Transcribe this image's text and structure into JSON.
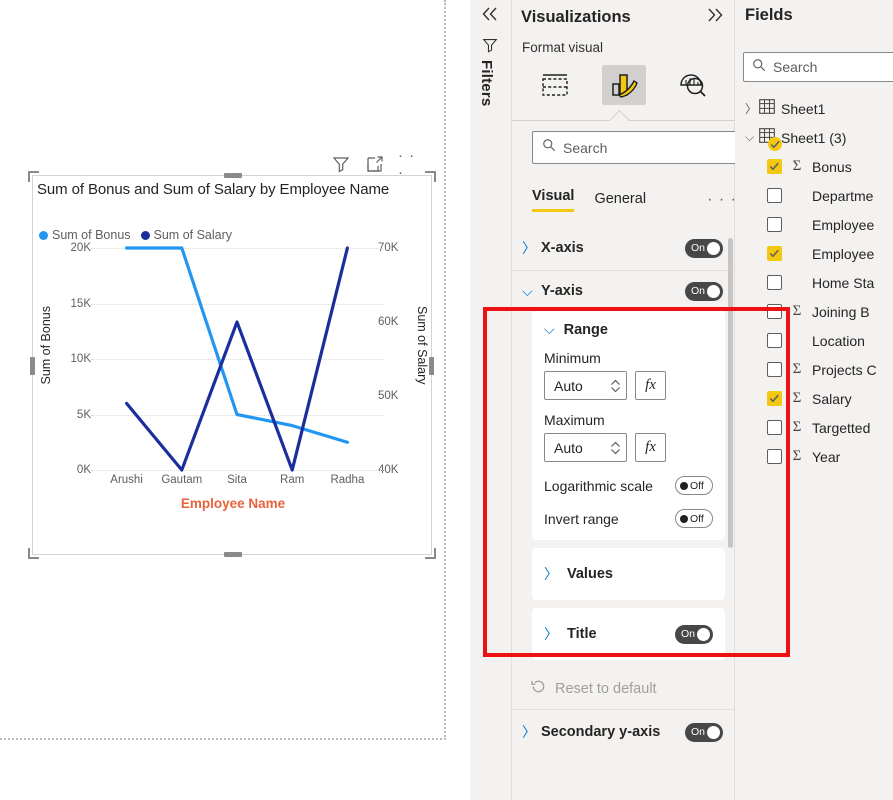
{
  "canvas": {
    "visual_header": {
      "filter_icon": "filter-icon",
      "focus_icon": "focus-mode-icon",
      "more_label": "· · ·"
    },
    "chart": {
      "title": "Sum of Bonus and Sum of Salary by Employee Name",
      "legend": [
        {
          "label": "Sum of Bonus",
          "color": "#2196f3"
        },
        {
          "label": "Sum of Salary",
          "color": "#1a2f9c"
        }
      ]
    }
  },
  "chart_data": {
    "type": "line",
    "title": "Sum of Bonus and Sum of Salary by Employee Name",
    "xlabel": "Employee Name",
    "categories": [
      "Arushi",
      "Gautam",
      "Sita",
      "Ram",
      "Radha"
    ],
    "grid": true,
    "legend_position": "top-left",
    "axes": {
      "left": {
        "label": "Sum of Bonus",
        "ticks": [
          "0K",
          "5K",
          "10K",
          "15K",
          "20K"
        ],
        "tick_values": [
          0,
          5000,
          10000,
          15000,
          20000
        ],
        "ylim": [
          0,
          20000
        ]
      },
      "right": {
        "label": "Sum of Salary",
        "ticks": [
          "40K",
          "50K",
          "60K",
          "70K"
        ],
        "tick_values": [
          40000,
          50000,
          60000,
          70000
        ],
        "ylim": [
          40000,
          70000
        ]
      }
    },
    "series": [
      {
        "name": "Sum of Bonus",
        "axis": "left",
        "color": "#2196f3",
        "values": [
          20000,
          20000,
          5000,
          4000,
          2500
        ]
      },
      {
        "name": "Sum of Salary",
        "axis": "right",
        "color": "#1a2f9c",
        "values": [
          49000,
          40000,
          60000,
          40000,
          70000
        ]
      }
    ]
  },
  "filters_rail": {
    "collapse_label": "«",
    "filter_icon": "filter-icon",
    "label": "Filters"
  },
  "visualizations": {
    "title": "Visualizations",
    "expand_label": "»",
    "format_visual_label": "Format visual",
    "tab_icons": [
      {
        "name": "build-visual-icon",
        "selected": false
      },
      {
        "name": "format-visual-icon",
        "selected": true
      },
      {
        "name": "analytics-icon",
        "selected": false
      }
    ],
    "search": {
      "placeholder": "Search",
      "value": ""
    },
    "subtabs": [
      {
        "label": "Visual",
        "active": true
      },
      {
        "label": "General",
        "active": false
      }
    ],
    "more_label": "· · ·",
    "sections": {
      "x_axis": {
        "label": "X-axis",
        "toggle": "On",
        "expanded": false
      },
      "y_axis": {
        "label": "Y-axis",
        "toggle": "On",
        "expanded": true
      },
      "range": {
        "label": "Range",
        "minimum_label": "Minimum",
        "minimum_value": "Auto",
        "maximum_label": "Maximum",
        "maximum_value": "Auto",
        "fx_label": "fx",
        "logarithmic_label": "Logarithmic scale",
        "logarithmic_toggle": "Off",
        "invert_label": "Invert range",
        "invert_toggle": "Off"
      },
      "values": {
        "label": "Values",
        "expanded": false
      },
      "title": {
        "label": "Title",
        "toggle": "On",
        "expanded": false
      },
      "reset": {
        "label": "Reset to default"
      },
      "secondary_y_axis": {
        "label": "Secondary y-axis",
        "toggle": "On",
        "expanded": false
      }
    }
  },
  "fields": {
    "title": "Fields",
    "search": {
      "placeholder": "Search",
      "value": ""
    },
    "tables": [
      {
        "name": "Sheet1",
        "expanded": false,
        "badge": false
      },
      {
        "name": "Sheet1 (3)",
        "expanded": true,
        "badge": true
      }
    ],
    "items": [
      {
        "label": "Bonus",
        "checked": true,
        "aggregate": true
      },
      {
        "label": "Departme",
        "checked": false,
        "aggregate": false
      },
      {
        "label": "Employee",
        "checked": false,
        "aggregate": false
      },
      {
        "label": "Employee",
        "checked": true,
        "aggregate": false
      },
      {
        "label": "Home Sta",
        "checked": false,
        "aggregate": false
      },
      {
        "label": "Joining B",
        "checked": false,
        "aggregate": true
      },
      {
        "label": "Location",
        "checked": false,
        "aggregate": false
      },
      {
        "label": "Projects C",
        "checked": false,
        "aggregate": true
      },
      {
        "label": "Salary",
        "checked": true,
        "aggregate": true
      },
      {
        "label": "Targetted",
        "checked": false,
        "aggregate": true
      },
      {
        "label": "Year",
        "checked": false,
        "aggregate": true
      }
    ]
  },
  "annotation": {
    "highlight_color": "#ee1111"
  }
}
